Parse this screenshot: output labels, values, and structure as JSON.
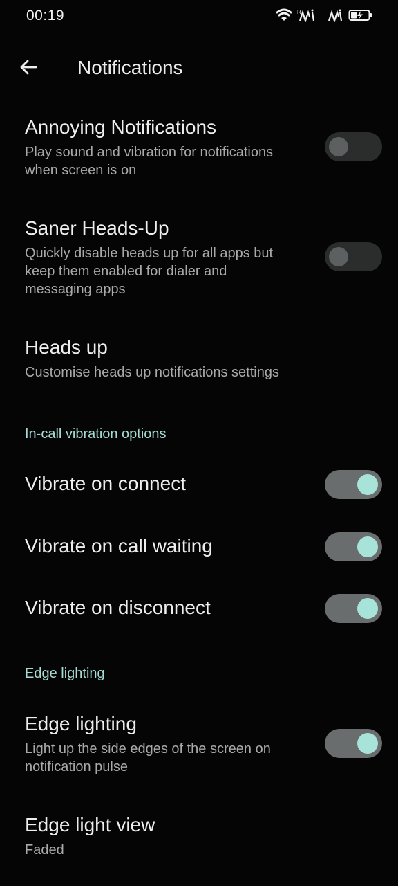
{
  "status_bar": {
    "time": "00:19",
    "icons": [
      "wifi-icon",
      "signal-r-icon",
      "signal-icon",
      "battery-charging-icon"
    ]
  },
  "app_bar": {
    "back_icon": "arrow-back-icon",
    "title": "Notifications"
  },
  "annoying_notifications": {
    "title": "Annoying Notifications",
    "summary": "Play sound and vibration for notifications when screen is on",
    "enabled": false
  },
  "saner_heads_up": {
    "title": "Saner Heads-Up",
    "summary": "Quickly disable heads up for all apps but keep them enabled for dialer and messaging apps",
    "enabled": false
  },
  "heads_up": {
    "title": "Heads up",
    "summary": "Customise heads up notifications settings"
  },
  "in_call_section": {
    "header": "In-call vibration options",
    "vibrate_on_connect": {
      "title": "Vibrate on connect",
      "enabled": true
    },
    "vibrate_on_call_waiting": {
      "title": "Vibrate on call waiting",
      "enabled": true
    },
    "vibrate_on_disconnect": {
      "title": "Vibrate on disconnect",
      "enabled": true
    }
  },
  "edge_lighting_section": {
    "header": "Edge lighting",
    "edge_lighting": {
      "title": "Edge lighting",
      "summary": "Light up the side edges of the screen on notification pulse",
      "enabled": true
    },
    "edge_light_view": {
      "title": "Edge light view",
      "summary": "Faded"
    }
  },
  "colors": {
    "background": "#050505",
    "accent": "#a8e3da",
    "section_header": "#a6dcd3",
    "switch_track_on": "#6a6d6d",
    "switch_track_off": "#2b2d2d"
  }
}
